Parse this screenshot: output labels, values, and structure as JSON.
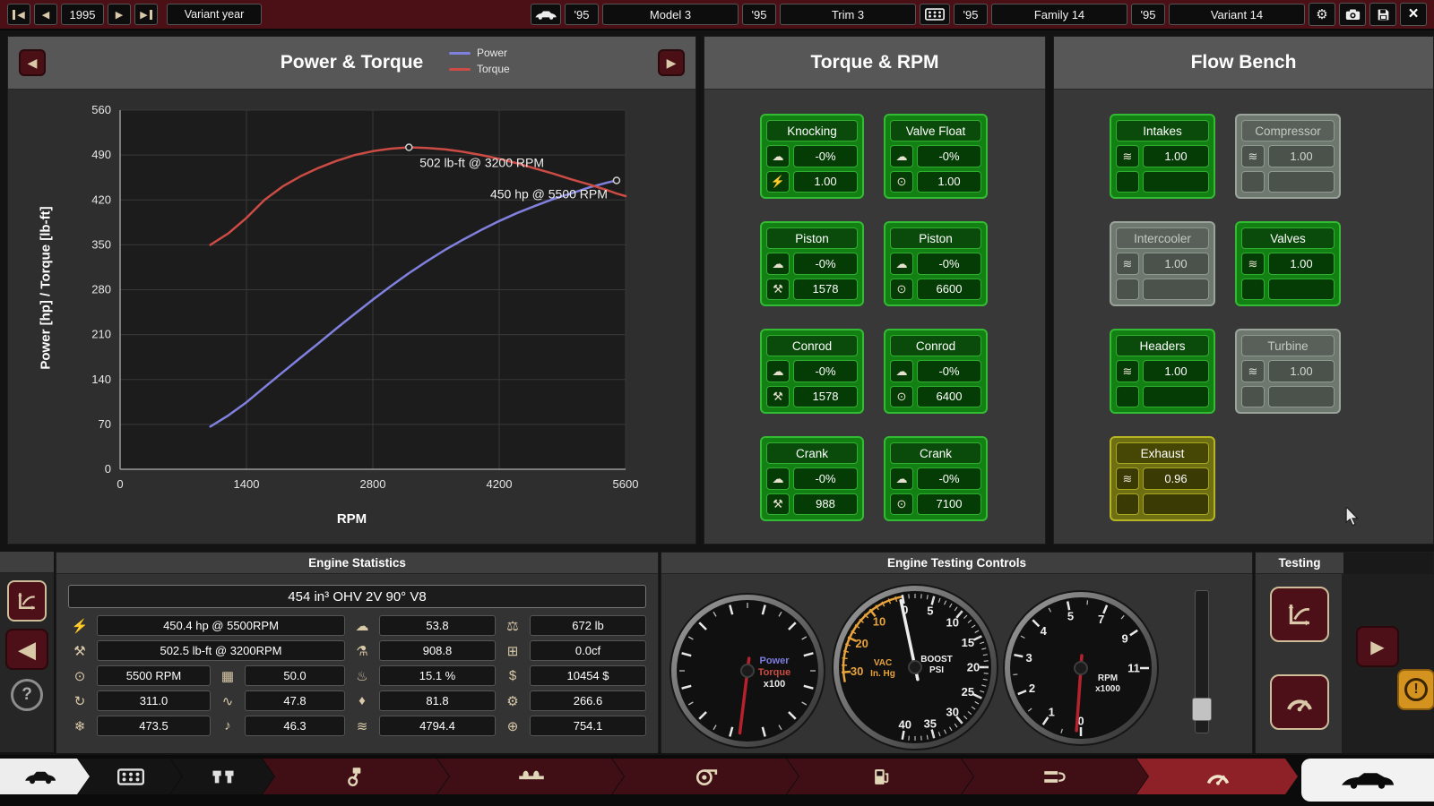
{
  "topbar": {
    "year_value": "1995",
    "variant_year_label": "Variant year",
    "model_year": "'95",
    "model_name": "Model 3",
    "trim_year": "'95",
    "trim_name": "Trim 3",
    "family_year": "'95",
    "family_name": "Family 14",
    "variant_year": "'95",
    "variant_name": "Variant 14"
  },
  "icons": {
    "prev": "◀",
    "next": "▶",
    "gear": "⚙",
    "close": "×",
    "help": "?",
    "play": "▶",
    "knock": "☁",
    "spark": "⚡",
    "stress": "⚒",
    "rpm": "⊙",
    "flow": "≋",
    "power": "⚡",
    "torque": "⚒",
    "weight": "⚖",
    "fuel_mix": "⚗",
    "dimensions": "⊞",
    "radiator": "▦",
    "efficiency": "♨",
    "cost": "$",
    "crank": "↻",
    "smoothness": "∿",
    "oil": "♦",
    "production": "⚙",
    "cooling": "❄",
    "loudness": "♪",
    "economy": "≋",
    "service": "⊕"
  },
  "power_torque_panel": {
    "title": "Power & Torque",
    "legend": [
      {
        "label": "Power",
        "color": "#8080df"
      },
      {
        "label": "Torque",
        "color": "#cc4b44"
      }
    ]
  },
  "chart_data": {
    "type": "line",
    "title": "Power & Torque",
    "xlabel": "RPM",
    "ylabel": "Power [hp] / Torque [lb-ft]",
    "xlim": [
      0,
      5600
    ],
    "ylim": [
      0,
      560
    ],
    "xticks": [
      0,
      1400,
      2800,
      4200,
      5600
    ],
    "yticks": [
      0,
      70,
      140,
      210,
      280,
      350,
      420,
      490,
      560
    ],
    "grid": true,
    "legend_position": "top-right",
    "series": [
      {
        "name": "Power",
        "color": "#8080df",
        "x": [
          1000,
          1200,
          1400,
          1600,
          1800,
          2000,
          2200,
          2400,
          2600,
          2800,
          3000,
          3200,
          3400,
          3600,
          3800,
          4000,
          4200,
          4400,
          4600,
          4800,
          5000,
          5200,
          5400,
          5500
        ],
        "y": [
          66.6,
          84.1,
          104.5,
          127.9,
          151.1,
          174.0,
          196.8,
          219.9,
          242.5,
          264.5,
          285.6,
          305.9,
          324.4,
          342.1,
          358.1,
          373.2,
          387.1,
          399.7,
          410.8,
          421.4,
          430.3,
          439.6,
          447.2,
          450.4
        ]
      },
      {
        "name": "Torque",
        "color": "#cc4b44",
        "x": [
          1000,
          1200,
          1400,
          1600,
          1800,
          2000,
          2200,
          2400,
          2600,
          2800,
          3000,
          3200,
          3400,
          3600,
          3800,
          4000,
          4200,
          4400,
          4600,
          4800,
          5000,
          5200,
          5400,
          5500,
          5600
        ],
        "y": [
          350,
          368,
          392,
          420,
          441,
          457,
          470,
          481,
          490,
          496,
          500,
          502,
          501,
          499,
          495,
          490,
          484,
          477,
          469,
          461,
          452,
          444,
          435,
          430,
          426
        ]
      }
    ],
    "markers": [
      {
        "x": 3200,
        "y": 502
      },
      {
        "x": 5500,
        "y": 450.4
      }
    ],
    "annotations": [
      {
        "text": "502 lb-ft @ 3200 RPM",
        "x": 3200,
        "y": 502,
        "dx": 12,
        "dy": 22,
        "anchor": "start"
      },
      {
        "text": "450 hp @ 5500 RPM",
        "x": 5500,
        "y": 450.4,
        "dx": -10,
        "dy": 20,
        "anchor": "end"
      }
    ]
  },
  "torque_rpm_panel": {
    "title": "Torque & RPM",
    "boxes": [
      {
        "title": "Knocking",
        "row1": "-0%",
        "row2": "1.00"
      },
      {
        "title": "Valve Float",
        "row1": "-0%",
        "row2": "1.00"
      },
      {
        "title": "Piston",
        "row1": "-0%",
        "row2": "1578"
      },
      {
        "title": "Piston",
        "row1": "-0%",
        "row2": "6600"
      },
      {
        "title": "Conrod",
        "row1": "-0%",
        "row2": "1578"
      },
      {
        "title": "Conrod",
        "row1": "-0%",
        "row2": "6400"
      },
      {
        "title": "Crank",
        "row1": "-0%",
        "row2": "988"
      },
      {
        "title": "Crank",
        "row1": "-0%",
        "row2": "7100"
      }
    ]
  },
  "flow_bench_panel": {
    "title": "Flow Bench",
    "boxes": [
      {
        "title": "Intakes",
        "value": "1.00",
        "state": "active"
      },
      {
        "title": "Compressor",
        "value": "1.00",
        "state": "disabled"
      },
      {
        "title": "Intercooler",
        "value": "1.00",
        "state": "disabled"
      },
      {
        "title": "Valves",
        "value": "1.00",
        "state": "active"
      },
      {
        "title": "Headers",
        "value": "1.00",
        "state": "active"
      },
      {
        "title": "Turbine",
        "value": "1.00",
        "state": "disabled"
      },
      {
        "title": "Exhaust",
        "value": "0.96",
        "state": "warning"
      }
    ]
  },
  "engine_stats": {
    "title": "Engine Statistics",
    "engine_name": "454 in³ OHV 2V 90° V8",
    "power": "450.4 hp @ 5500RPM",
    "torque": "502.5 lb-ft @ 3200RPM",
    "max_rpm": "5500 RPM",
    "knock": "53.8",
    "weight": "672 lb",
    "fuel_mix": "908.8",
    "size": "0.0cf",
    "radiator": "50.0",
    "efficiency": "15.1 %",
    "cost": "10454 $",
    "crank_balance": "311.0",
    "smoothness": "47.8",
    "oil": "81.8",
    "production_units": "266.6",
    "cooling": "473.5",
    "loudness": "46.3",
    "economy": "4794.4",
    "service_cost": "754.1"
  },
  "testing_controls": {
    "title": "Engine Testing Controls",
    "dyno_gauge": {
      "line1": "Power",
      "line2": "Torque",
      "line3": "x100"
    },
    "boost_gauge": {
      "vac_line1": "VAC",
      "vac_line2": "In. Hg",
      "boost_line1": "BOOST",
      "boost_line2": "PSI",
      "boost_labels": [
        "0",
        "5",
        "10",
        "15",
        "20",
        "25",
        "30",
        "35",
        "40"
      ],
      "vac_labels": [
        "10",
        "20",
        "30"
      ]
    },
    "tach_gauge": {
      "line1": "RPM",
      "line2": "x1000",
      "labels": [
        "0",
        "1",
        "2",
        "3",
        "4",
        "5",
        "7",
        "9",
        "11"
      ]
    }
  },
  "testing_panel": {
    "title": "Testing"
  }
}
